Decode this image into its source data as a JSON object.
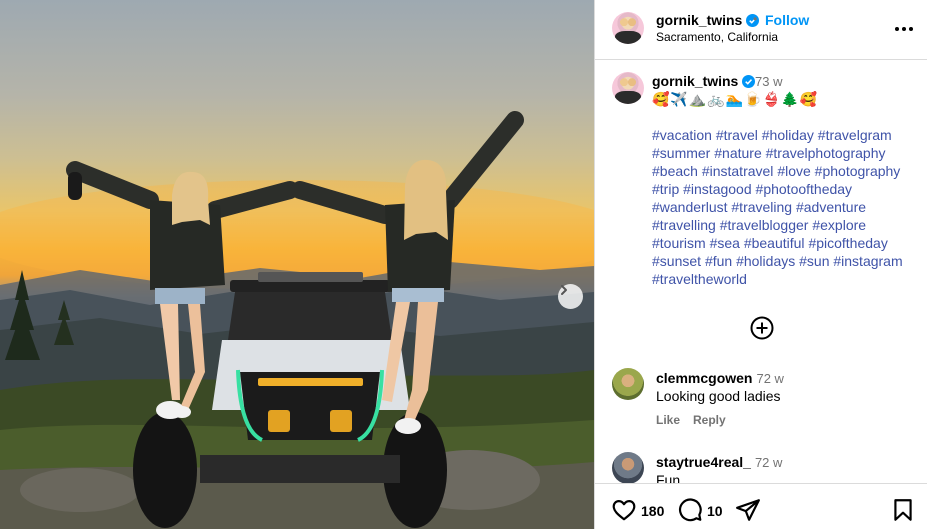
{
  "post": {
    "username": "gornik_twins",
    "follow_label": "Follow",
    "separator": "•",
    "location": "Sacramento, California"
  },
  "caption": {
    "username": "gornik_twins",
    "time": "73 w",
    "emojis": "🥰✈️⛰️🚲🏊🍺👙🌲🥰",
    "hashtags": [
      "#vacation",
      "#travel",
      "#holiday",
      "#travelgram",
      "#summer",
      "#nature",
      "#travelphotography",
      "#beach",
      "#instatravel",
      "#love",
      "#photography",
      "#trip",
      "#instagood",
      "#photooftheday",
      "#wanderlust",
      "#traveling",
      "#adventure",
      "#travelling",
      "#travelblogger",
      "#explore",
      "#tourism",
      "#sea",
      "#beautiful",
      "#picoftheday",
      "#sunset",
      "#fun",
      "#holidays",
      "#sun",
      "#instagram",
      "#traveltheworld"
    ]
  },
  "comments": [
    {
      "username": "clemmcgowen",
      "time": "72 w",
      "text": "Looking good ladies",
      "like_label": "Like",
      "reply_label": "Reply"
    },
    {
      "username": "staytrue4real_",
      "time": "72 w",
      "text": "Fun"
    }
  ],
  "actions": {
    "likes": "180",
    "comments": "10"
  },
  "colors": {
    "link": "#0095f6",
    "hashtag": "#3f53a8",
    "muted": "#737373",
    "border": "#dbdbdb"
  }
}
